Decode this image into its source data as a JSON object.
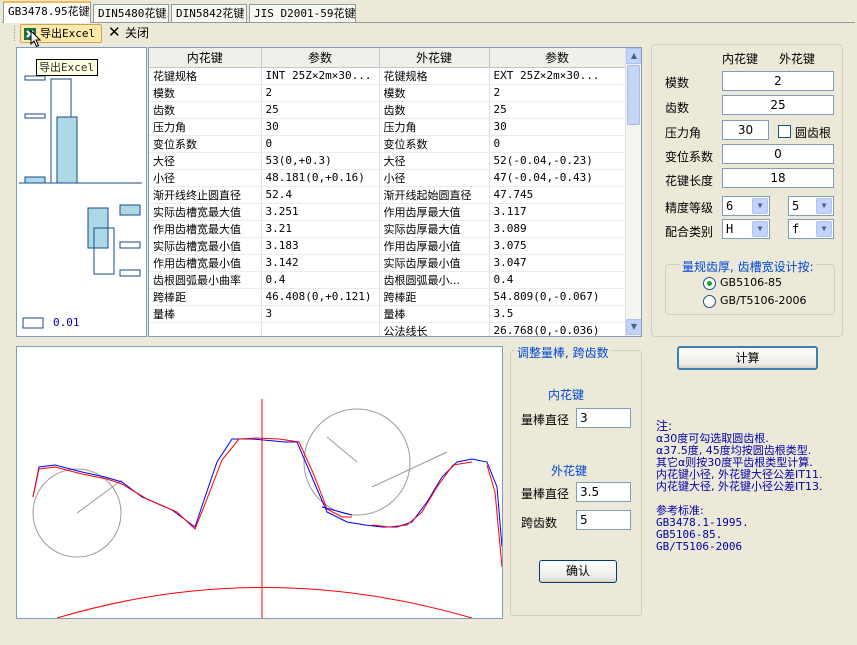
{
  "tabs": [
    "GB3478.95花键",
    "DIN5480花键",
    "DIN5842花键",
    "JIS D2001-59花键"
  ],
  "toolbar": {
    "export_label": "导出Excel",
    "close_label": "关闭",
    "tooltip": "导出Excel"
  },
  "preview": {
    "scale_label": "0.01"
  },
  "table": {
    "headers": [
      "内花键",
      "参数",
      "外花键",
      "参数"
    ],
    "rows": [
      [
        "花键规格",
        "INT 25Z×2m×30...",
        "花键规格",
        "EXT 25Z×2m×30..."
      ],
      [
        "模数",
        "2",
        "模数",
        "2"
      ],
      [
        "齿数",
        "25",
        "齿数",
        "25"
      ],
      [
        "压力角",
        "30",
        "压力角",
        "30"
      ],
      [
        "变位系数",
        "0",
        "变位系数",
        "0"
      ],
      [
        "大径",
        "53(0,+0.3)",
        "大径",
        "52(-0.04,-0.23)"
      ],
      [
        "小径",
        "48.181(0,+0.16)",
        "小径",
        "47(-0.04,-0.43)"
      ],
      [
        "渐开线终止圆直径",
        "52.4",
        "渐开线起始圆直径",
        "47.745"
      ],
      [
        "实际齿槽宽最大值",
        "3.251",
        "作用齿厚最大值",
        "3.117"
      ],
      [
        "作用齿槽宽最大值",
        "3.21",
        "实际齿厚最大值",
        "3.089"
      ],
      [
        "实际齿槽宽最小值",
        "3.183",
        "作用齿厚最小值",
        "3.075"
      ],
      [
        "作用齿槽宽最小值",
        "3.142",
        "实际齿厚最小值",
        "3.047"
      ],
      [
        "齿根圆弧最小曲率",
        "0.4",
        "齿根圆弧最小...",
        "0.4"
      ],
      [
        "跨棒距",
        "46.408(0,+0.121)",
        "跨棒距",
        "54.809(0,-0.067)"
      ],
      [
        "量棒",
        "3",
        "量棒",
        "3.5"
      ],
      [
        "",
        "",
        "公法线长",
        "26.768(0,-0.036)"
      ]
    ]
  },
  "params": {
    "col_internal": "内花键",
    "col_external": "外花键",
    "module_label": "模数",
    "module_value": "2",
    "teeth_label": "齿数",
    "teeth_value": "25",
    "pressure_angle_label": "压力角",
    "pressure_angle_value": "30",
    "round_root_label": "圆齿根",
    "shift_label": "变位系数",
    "shift_value": "0",
    "length_label": "花键长度",
    "length_value": "18",
    "accuracy_label": "精度等级",
    "accuracy_internal": "6",
    "accuracy_external": "5",
    "fit_label": "配合类别",
    "fit_internal": "H",
    "fit_external": "f"
  },
  "standard_group": {
    "title": "量规齿厚, 齿槽宽设计按:",
    "option1": "GB5106-85",
    "option2": "GB/T5106-2006",
    "selected": "GB5106-85"
  },
  "calc_button": "计算",
  "adjust_group": {
    "title": "调整量棒, 跨齿数",
    "internal_title": "内花键",
    "internal_pin_label": "量棒直径",
    "internal_pin_value": "3",
    "external_title": "外花键",
    "external_pin_label": "量棒直径",
    "external_pin_value": "3.5",
    "span_label": "跨齿数",
    "span_value": "5",
    "confirm_button": "确认"
  },
  "notes": {
    "title": "注:",
    "line1": "α30度可勾选取圆齿根.",
    "line2": "α37.5度, 45度均按圆齿根类型.",
    "line3": "其它α则按30度平齿根类型计算.",
    "line4": "内花键小径, 外花键大径公差IT11.",
    "line5": "内花键大径, 外花键小径公差IT13.",
    "ref_title": "参考标准:",
    "ref1": "GB3478.1-1995.",
    "ref2": "GB5106-85.",
    "ref3": "GB/T5106-2006"
  },
  "colors": {
    "accent_blue": "#0046d5",
    "note_blue": "#0000aa",
    "curve_red": "#ff0000",
    "curve_blue": "#0000ff",
    "tab_highlight": "#f9b74c"
  }
}
